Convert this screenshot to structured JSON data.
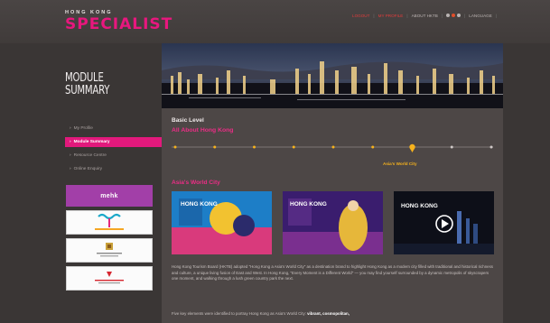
{
  "brand": {
    "line1": "HONG KONG",
    "line2": "SPECIALIST"
  },
  "topnav": {
    "items": [
      "LOGOUT",
      "MY PROFILE",
      "ABOUT HKTB"
    ],
    "language": "LANGUAGE",
    "hot_color": "#e33c3c",
    "dot_colors": [
      "#b9b3b2",
      "#e24e2a",
      "#b9b3b2"
    ]
  },
  "sidebar": {
    "title_line1": "MODULE",
    "title_line2": "SUMMARY",
    "items": [
      {
        "label": "My Profile"
      },
      {
        "label": "Module Summary"
      },
      {
        "label": "Resource Centre"
      },
      {
        "label": "Online Enquiry"
      }
    ],
    "accent": "#e2197c",
    "logos": [
      {
        "name": "mehk-logo",
        "text": "mehk"
      },
      {
        "name": "partner-logo-1"
      },
      {
        "name": "partner-logo-2"
      },
      {
        "name": "partner-logo-3"
      }
    ]
  },
  "main": {
    "level": "Basic Level",
    "topic": "All About Hong Kong",
    "timeline": {
      "current_label": "Asia's World City",
      "stops": 9,
      "current_index": 6
    },
    "section_title": "Asia's World City",
    "thumbnails": [
      {
        "name": "thumbnail-festival",
        "text": "HONG KONG"
      },
      {
        "name": "thumbnail-performer",
        "text": "HONG KONG"
      },
      {
        "name": "thumbnail-video",
        "text": "HONG KONG"
      }
    ],
    "paragraph1": "Hong Kong Tourism Board (HKTB) adopted \"Hong Kong a Asia's World City\" as a destination brand to highlight Hong Kong as a modern city filled with traditional and historical richness and culture, a unique living fusion of East and West. In Hong Kong, \"Every Moment is a Different World\" — you may find yourself surrounded by a dynamic metropolis of skyscrapers one moment, and walking through a lush green country park the next.",
    "paragraph2_start": "Five key elements were identified to portray Hong Kong as Asia's World City: ",
    "paragraph2_bold": "vibrant, cosmopolitan,"
  }
}
